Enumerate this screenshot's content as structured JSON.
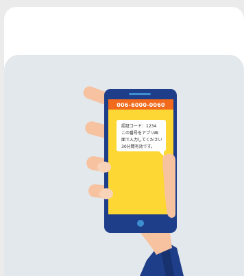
{
  "sms_screen": {
    "sender_number": "006-6000-0060",
    "message_lines": [
      "認証コード：1234",
      "この番号をアプリ画",
      "面で入力してください",
      "30分間有効です。"
    ]
  },
  "colors": {
    "page_background": "#ebebeb",
    "card_background": "#ffffff",
    "illustration_background": "#e3e8ec",
    "phone_body": "#1f3e8a",
    "phone_screen": "#fdd835",
    "phone_header": "#f26b1d",
    "phone_accent": "#3d8fd1",
    "skin": "#f6c2a0",
    "sleeve": "#1f3e8a"
  },
  "icons": {
    "speech_bubble": "speech-bubble-icon",
    "home_button": "home-button-icon"
  }
}
